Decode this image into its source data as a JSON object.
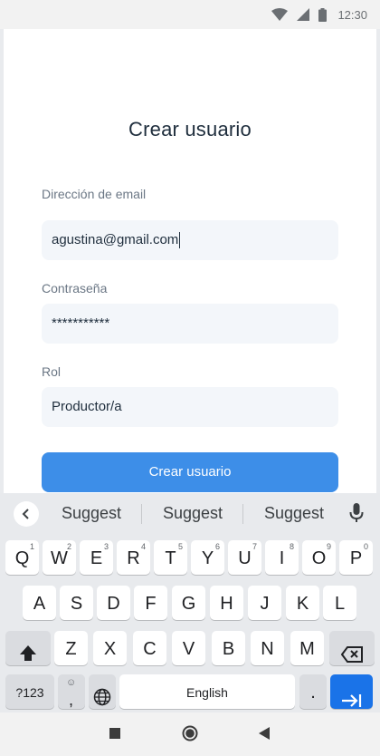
{
  "status_bar": {
    "time": "12:30",
    "icons": [
      "wifi-icon",
      "signal-icon",
      "battery-icon"
    ]
  },
  "form": {
    "title": "Crear usuario",
    "email": {
      "label": "Dirección de email",
      "value": "agustina@gmail.com"
    },
    "password": {
      "label": "Contraseña",
      "value": "***********"
    },
    "role": {
      "label": "Rol",
      "value": "Productor/a"
    },
    "submit_label": "Crear usuario"
  },
  "keyboard": {
    "suggestions": [
      "Suggest",
      "Suggest",
      "Suggest"
    ],
    "row1": [
      {
        "key": "Q",
        "hint": "1"
      },
      {
        "key": "W",
        "hint": "2"
      },
      {
        "key": "E",
        "hint": "3"
      },
      {
        "key": "R",
        "hint": "4"
      },
      {
        "key": "T",
        "hint": "5"
      },
      {
        "key": "Y",
        "hint": "6"
      },
      {
        "key": "U",
        "hint": "7"
      },
      {
        "key": "I",
        "hint": "8"
      },
      {
        "key": "O",
        "hint": "9"
      },
      {
        "key": "P",
        "hint": "0"
      }
    ],
    "row2": [
      "A",
      "S",
      "D",
      "F",
      "G",
      "H",
      "J",
      "K",
      "L"
    ],
    "row3": [
      "Z",
      "X",
      "C",
      "V",
      "B",
      "N",
      "M"
    ],
    "symbols_label": "?123",
    "emoji_comma": ",",
    "space_label": "English",
    "period": "."
  },
  "colors": {
    "primary": "#3d8ee8",
    "keyboard_action": "#1a73e8"
  }
}
